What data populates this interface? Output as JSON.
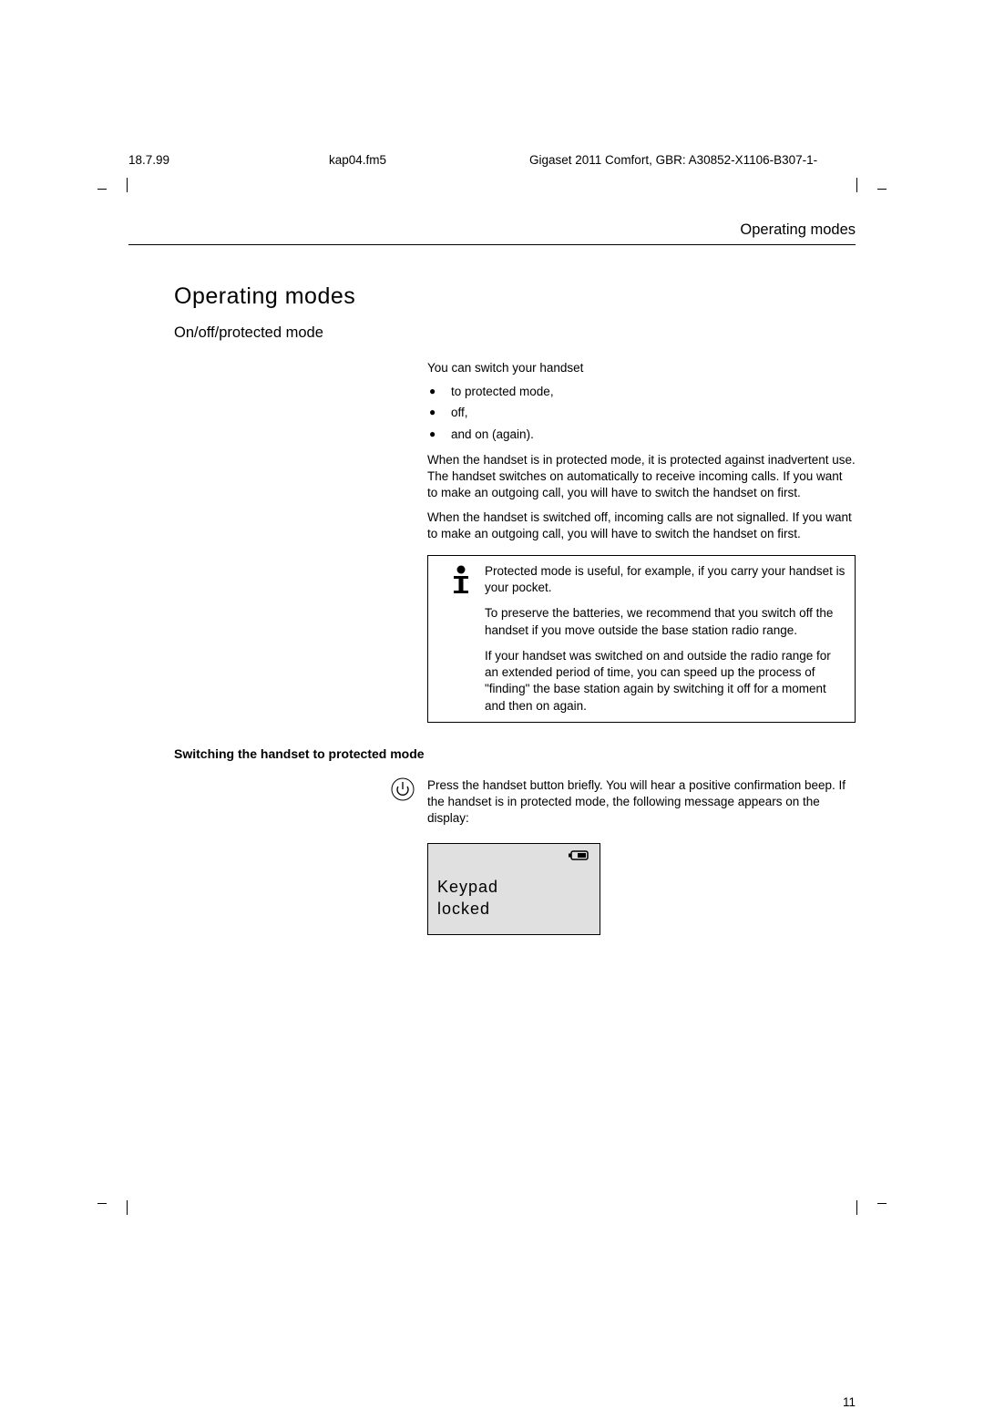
{
  "header": {
    "date": "18.7.99",
    "file": "kap04.fm5",
    "doc_id": "Gigaset 2011 Comfort, GBR: A30852-X1106-B307-1-"
  },
  "running_head": "Operating modes",
  "h1": "Operating modes",
  "h2": "On/off/protected mode",
  "intro": "You can switch your handset",
  "bullets": [
    "to protected mode,",
    "off,",
    "and on (again)."
  ],
  "para1": "When the handset is in protected mode, it is protected against inadvertent use. The handset switches on automatically to receive incoming calls. If you want to make an outgoing call, you will have to switch the handset on first.",
  "para2": "When the handset is switched off, incoming calls are not signalled. If you want to make an outgoing call, you will have to switch the handset on first.",
  "info": {
    "p1": "Protected mode is useful, for example, if you carry your handset is your pocket.",
    "p2": "To preserve the batteries, we recommend that you switch off the handset if you move outside the base station radio range.",
    "p3": "If your handset was switched on and outside the radio range for an extended period of time, you can speed up the process of \"finding\" the base station again by switching it off for a moment and then on again."
  },
  "h3": "Switching the handset to protected mode",
  "step1": "Press the handset button briefly. You will hear a positive confirmation beep. If the handset is in protected mode, the following message appears on the display:",
  "display": {
    "line1": "Keypad",
    "line2": "locked"
  },
  "page_num": "11"
}
